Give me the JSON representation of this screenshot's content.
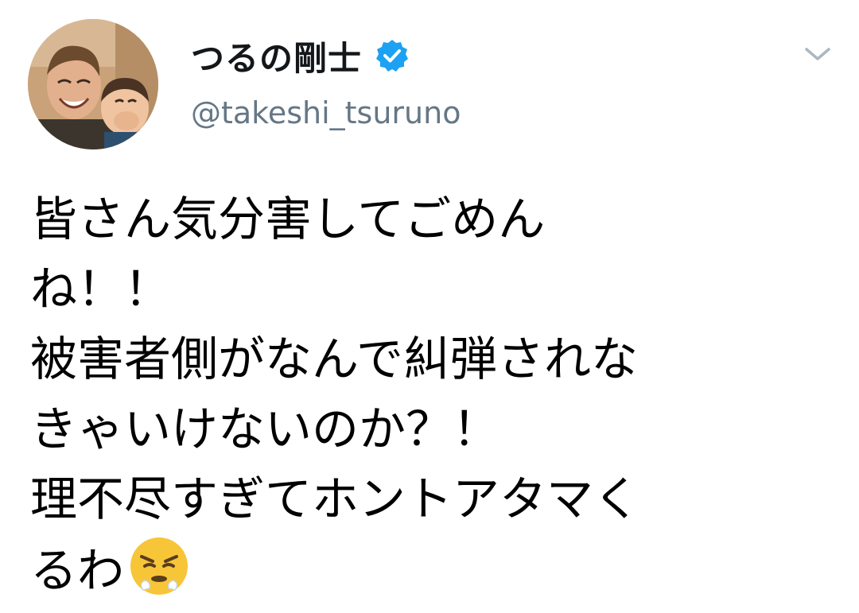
{
  "tweet": {
    "author": {
      "display_name": "つるの剛士",
      "handle": "@takeshi_tsuruno",
      "verified": true,
      "avatar_icon": "profile-photo"
    },
    "menu_icon": "chevron-down-icon",
    "text_lines": [
      "皆さん気分害してごめん",
      "ね！！",
      "被害者側がなんで糾弾されな",
      "きゃいけないのか？！",
      "理不尽すぎてホントアタマく",
      "るわ"
    ],
    "trailing_emoji": "face-with-steam-from-nose-icon"
  },
  "colors": {
    "verified_blue": "#1da1f2",
    "handle_gray": "#657786",
    "caret_gray": "#aab8c2",
    "text": "#000000",
    "emoji_yellow": "#f7c538"
  }
}
